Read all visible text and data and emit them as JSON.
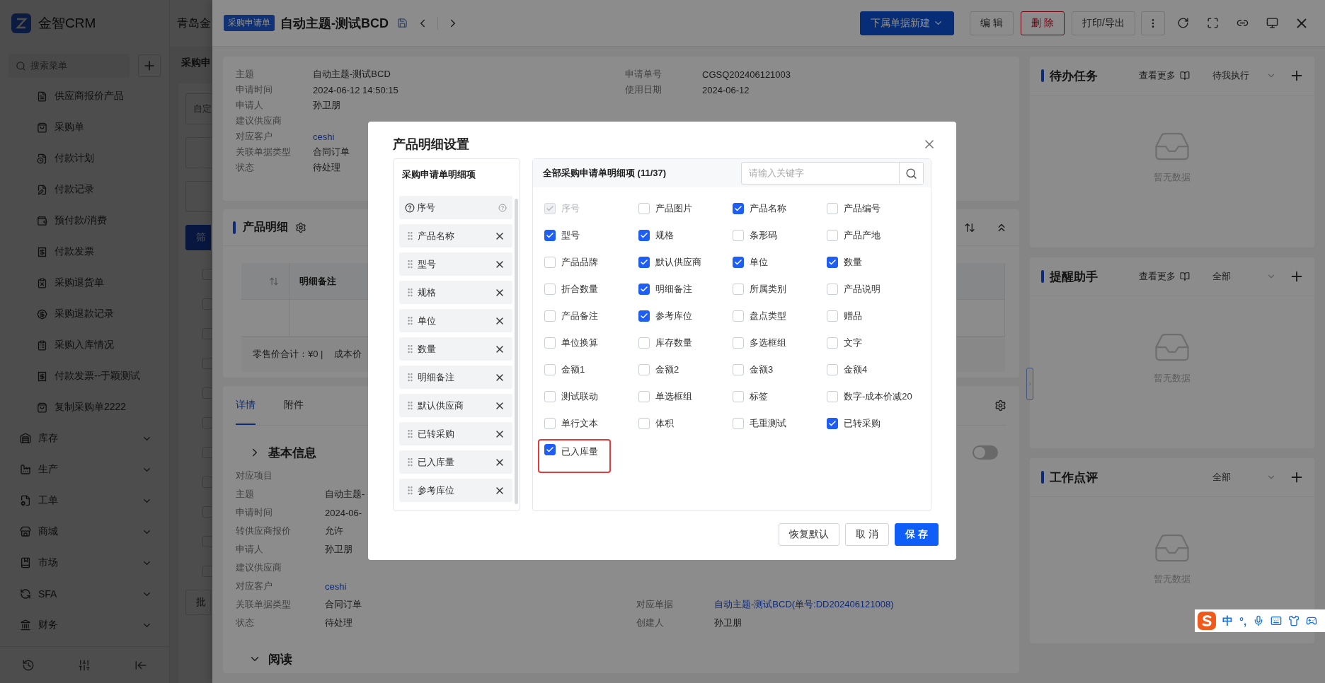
{
  "sidebar": {
    "logo": "金智CRM",
    "search_placeholder": "搜索菜单",
    "items": [
      {
        "label": "供应商报价产品"
      },
      {
        "label": "采购单"
      },
      {
        "label": "付款计划"
      },
      {
        "label": "付款记录"
      },
      {
        "label": "预付款/消费"
      },
      {
        "label": "付款发票"
      },
      {
        "label": "采购退货单"
      },
      {
        "label": "采购退款记录"
      },
      {
        "label": "采购入库情况"
      },
      {
        "label": "付款发票--于颖测试"
      },
      {
        "label": "复制采购单2222"
      }
    ],
    "groups": [
      {
        "label": "库存"
      },
      {
        "label": "生产"
      },
      {
        "label": "工单"
      },
      {
        "label": "商城"
      },
      {
        "label": "市场"
      },
      {
        "label": "SFA"
      },
      {
        "label": "财务"
      }
    ]
  },
  "behind_page": {
    "company": "青岛金",
    "title": "采购申",
    "filter_placeholder": "自定",
    "filter_button": "筛",
    "batch_button": "批",
    "rows": [
      {
        "checked": false
      },
      {
        "checked": false
      },
      {
        "checked": false
      },
      {
        "checked": false
      },
      {
        "checked": false
      },
      {
        "checked": false
      },
      {
        "checked": false
      },
      {
        "checked": false
      },
      {
        "checked": false
      },
      {
        "checked": false
      },
      {
        "checked": false
      }
    ]
  },
  "drawer": {
    "tag": "采购申请单",
    "title": "自动主题-测试BCD",
    "buttons": [
      {
        "label": "下属单据新建",
        "kind": "primary"
      },
      {
        "label": "编 辑",
        "kind": "default"
      },
      {
        "label": "删 除",
        "kind": "danger"
      },
      {
        "label": "打印/导出",
        "kind": "default"
      }
    ],
    "info": {
      "left": [
        {
          "label": "主题",
          "value": "自动主题-测试BCD"
        },
        {
          "label": "申请时间",
          "value": "2024-06-12 14:50:15"
        },
        {
          "label": "申请人",
          "value": "孙卫朋"
        },
        {
          "label": "建议供应商"
        },
        {
          "label": "对应客户",
          "value": "ceshi",
          "kind": "link"
        },
        {
          "label": "关联单据类型",
          "value": "合同订单"
        },
        {
          "label": "状态",
          "value": "待处理"
        }
      ],
      "right": [
        {
          "label": "申请单号",
          "value": "CGSQ202406121003"
        },
        {
          "label": "使用日期",
          "value": "2024-06-12"
        }
      ]
    },
    "products": {
      "title": "产品明细",
      "columns": [
        "明细备注"
      ],
      "summary": "零售价合计：¥0 |",
      "summary_2": "成本价"
    },
    "tabs": [
      {
        "label": "详情",
        "selected": true
      },
      {
        "label": "附件",
        "selected": false
      }
    ],
    "section": {
      "title": "基本信息",
      "toggle_on": false,
      "left": [
        {
          "label": "对应项目"
        },
        {
          "label": "主题",
          "value": "自动主题-"
        },
        {
          "label": "申请时间",
          "value": "2024-06-"
        },
        {
          "label": "转供应商报价",
          "value": "允许"
        },
        {
          "label": "申请人",
          "value": "孙卫朋"
        },
        {
          "label": "建议供应商"
        },
        {
          "label": "对应客户",
          "value": "ceshi",
          "kind": "link"
        },
        {
          "label": "关联单据类型",
          "value": "合同订单"
        },
        {
          "label": "状态",
          "value": "待处理"
        }
      ],
      "right": [
        {
          "label": "对应单据",
          "value": "自动主题-测试BCD(单号:DD202406121008)",
          "kind": "link"
        },
        {
          "label": "创建人",
          "value": "孙卫朋"
        }
      ]
    },
    "section_2": {
      "title": "阅读"
    }
  },
  "panels": [
    {
      "title": "待办任务",
      "more": "查看更多",
      "filter": "待我执行",
      "empty": "暂无数据"
    },
    {
      "title": "提醒助手",
      "more": "查看更多",
      "filter": "全部",
      "empty": "暂无数据"
    },
    {
      "title": "工作点评",
      "filter": "全部",
      "empty": "暂无数据"
    }
  ],
  "modal": {
    "title": "产品明细设置",
    "left_title": "采购申请单明细项",
    "left_items": [
      {
        "label": "序号",
        "kind": "fixed"
      },
      {
        "label": "产品名称",
        "kind": "movable"
      },
      {
        "label": "型号",
        "kind": "movable"
      },
      {
        "label": "规格",
        "kind": "movable"
      },
      {
        "label": "单位",
        "kind": "movable"
      },
      {
        "label": "数量",
        "kind": "movable"
      },
      {
        "label": "明细备注",
        "kind": "movable"
      },
      {
        "label": "默认供应商",
        "kind": "movable"
      },
      {
        "label": "已转采购",
        "kind": "movable"
      },
      {
        "label": "已入库量",
        "kind": "movable"
      },
      {
        "label": "参考库位",
        "kind": "movable"
      }
    ],
    "right_title": "全部采购申请单明细项 (11/37)",
    "search_placeholder": "请输入关键字",
    "options": [
      {
        "label": "序号",
        "checked": true,
        "disabled": true,
        "highlighted": false
      },
      {
        "label": "产品图片",
        "checked": false,
        "disabled": false,
        "highlighted": false
      },
      {
        "label": "产品名称",
        "checked": true,
        "disabled": false,
        "highlighted": false
      },
      {
        "label": "产品编号",
        "checked": false,
        "disabled": false,
        "highlighted": false
      },
      {
        "label": "型号",
        "checked": true,
        "disabled": false,
        "highlighted": false
      },
      {
        "label": "规格",
        "checked": true,
        "disabled": false,
        "highlighted": false
      },
      {
        "label": "条形码",
        "checked": false,
        "disabled": false,
        "highlighted": false
      },
      {
        "label": "产品产地",
        "checked": false,
        "disabled": false,
        "highlighted": false
      },
      {
        "label": "产品品牌",
        "checked": false,
        "disabled": false,
        "highlighted": false
      },
      {
        "label": "默认供应商",
        "checked": true,
        "disabled": false,
        "highlighted": false
      },
      {
        "label": "单位",
        "checked": true,
        "disabled": false,
        "highlighted": false
      },
      {
        "label": "数量",
        "checked": true,
        "disabled": false,
        "highlighted": false
      },
      {
        "label": "折合数量",
        "checked": false,
        "disabled": false,
        "highlighted": false
      },
      {
        "label": "明细备注",
        "checked": true,
        "disabled": false,
        "highlighted": false
      },
      {
        "label": "所属类别",
        "checked": false,
        "disabled": false,
        "highlighted": false
      },
      {
        "label": "产品说明",
        "checked": false,
        "disabled": false,
        "highlighted": false
      },
      {
        "label": "产品备注",
        "checked": false,
        "disabled": false,
        "highlighted": false
      },
      {
        "label": "参考库位",
        "checked": true,
        "disabled": false,
        "highlighted": false
      },
      {
        "label": "盘点类型",
        "checked": false,
        "disabled": false,
        "highlighted": false
      },
      {
        "label": "赠品",
        "checked": false,
        "disabled": false,
        "highlighted": false
      },
      {
        "label": "单位换算",
        "checked": false,
        "disabled": false,
        "highlighted": false
      },
      {
        "label": "库存数量",
        "checked": false,
        "disabled": false,
        "highlighted": false
      },
      {
        "label": "多选框组",
        "checked": false,
        "disabled": false,
        "highlighted": false
      },
      {
        "label": "文字",
        "checked": false,
        "disabled": false,
        "highlighted": false
      },
      {
        "label": "金额1",
        "checked": false,
        "disabled": false,
        "highlighted": false
      },
      {
        "label": "金额2",
        "checked": false,
        "disabled": false,
        "highlighted": false
      },
      {
        "label": "金额3",
        "checked": false,
        "disabled": false,
        "highlighted": false
      },
      {
        "label": "金额4",
        "checked": false,
        "disabled": false,
        "highlighted": false
      },
      {
        "label": "测试联动",
        "checked": false,
        "disabled": false,
        "highlighted": false
      },
      {
        "label": "单选框组",
        "checked": false,
        "disabled": false,
        "highlighted": false
      },
      {
        "label": "标签",
        "checked": false,
        "disabled": false,
        "highlighted": false
      },
      {
        "label": "数字-成本价减20",
        "checked": false,
        "disabled": false,
        "highlighted": false
      },
      {
        "label": "单行文本",
        "checked": false,
        "disabled": false,
        "highlighted": false
      },
      {
        "label": "体积",
        "checked": false,
        "disabled": false,
        "highlighted": false
      },
      {
        "label": "毛重测试",
        "checked": false,
        "disabled": false,
        "highlighted": false
      },
      {
        "label": "已转采购",
        "checked": true,
        "disabled": false,
        "highlighted": false
      },
      {
        "label": "已入库量",
        "checked": true,
        "disabled": false,
        "highlighted": true
      }
    ],
    "buttons": [
      {
        "label": "恢复默认",
        "kind": "default"
      },
      {
        "label": "取 消",
        "kind": "default"
      },
      {
        "label": "保 存",
        "kind": "primary"
      }
    ]
  },
  "ime": {
    "mode": "中",
    "punct": "°,"
  }
}
